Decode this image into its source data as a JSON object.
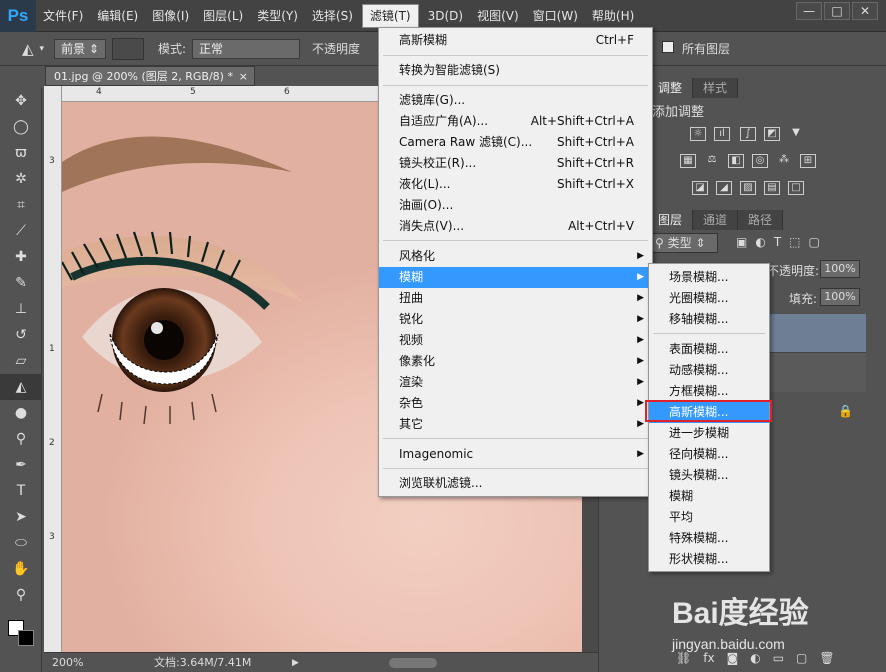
{
  "app": {
    "logo": "Ps"
  },
  "menubar": [
    "文件(F)",
    "编辑(E)",
    "图像(I)",
    "图层(L)",
    "类型(Y)",
    "选择(S)",
    "滤镜(T)",
    "3D(D)",
    "视图(V)",
    "窗口(W)",
    "帮助(H)"
  ],
  "window_controls": [
    "—",
    "□",
    "✕"
  ],
  "options": {
    "fg_label": "前景",
    "mode_label": "模式:",
    "mode_value": "正常",
    "opacity_label": "不透明度",
    "all_layers": "所有图层"
  },
  "document": {
    "tab_title": "01.jpg @ 200% (图层 2, RGB/8) *",
    "close": "×",
    "zoom": "200%",
    "doc_info": "文档:3.64M/7.41M"
  },
  "ruler": {
    "top": [
      "4",
      "5",
      "6"
    ],
    "left": [
      "3",
      "1",
      "2",
      "3"
    ]
  },
  "panels": {
    "adjust_tabs": [
      "调整",
      "样式"
    ],
    "adjust_title": "添加调整",
    "layer_tabs": [
      "图层",
      "通道",
      "路径"
    ],
    "kind_label": "类型",
    "opacity_label": "不透明度:",
    "opacity_value": "100%",
    "fill_label": "填充:",
    "fill_value": "100%"
  },
  "filter_menu": {
    "items": [
      {
        "label": "高斯模糊",
        "shortcut": "Ctrl+F"
      },
      {
        "label": "转换为智能滤镜(S)",
        "shortcut": ""
      },
      {
        "label": "滤镜库(G)...",
        "shortcut": ""
      },
      {
        "label": "自适应广角(A)...",
        "shortcut": "Alt+Shift+Ctrl+A"
      },
      {
        "label": "Camera Raw 滤镜(C)...",
        "shortcut": "Shift+Ctrl+A"
      },
      {
        "label": "镜头校正(R)...",
        "shortcut": "Shift+Ctrl+R"
      },
      {
        "label": "液化(L)...",
        "shortcut": "Shift+Ctrl+X"
      },
      {
        "label": "油画(O)...",
        "shortcut": ""
      },
      {
        "label": "消失点(V)...",
        "shortcut": "Alt+Ctrl+V"
      },
      {
        "label": "风格化",
        "shortcut": ""
      },
      {
        "label": "模糊",
        "shortcut": ""
      },
      {
        "label": "扭曲",
        "shortcut": ""
      },
      {
        "label": "锐化",
        "shortcut": ""
      },
      {
        "label": "视频",
        "shortcut": ""
      },
      {
        "label": "像素化",
        "shortcut": ""
      },
      {
        "label": "渲染",
        "shortcut": ""
      },
      {
        "label": "杂色",
        "shortcut": ""
      },
      {
        "label": "其它",
        "shortcut": ""
      },
      {
        "label": "Imagenomic",
        "shortcut": ""
      },
      {
        "label": "浏览联机滤镜...",
        "shortcut": ""
      }
    ]
  },
  "blur_submenu": [
    "场景模糊...",
    "光圈模糊...",
    "移轴模糊...",
    "表面模糊...",
    "动感模糊...",
    "方框模糊...",
    "高斯模糊...",
    "进一步模糊",
    "径向模糊...",
    "镜头模糊...",
    "模糊",
    "平均",
    "特殊模糊...",
    "形状模糊..."
  ],
  "watermark": {
    "logo": "Bai度经验",
    "url": "jingyan.baidu.com"
  },
  "colors": {
    "menu_highlight": "#3399ff",
    "callout": "#e0202a",
    "layer_selected": "#6d7e95"
  }
}
